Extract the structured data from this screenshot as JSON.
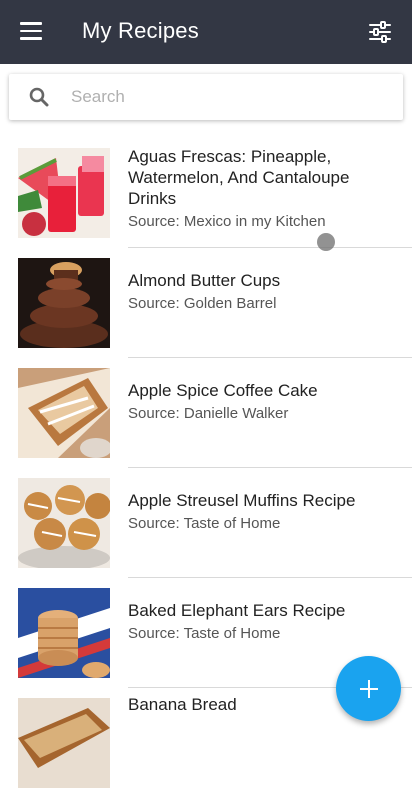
{
  "appbar": {
    "title": "My Recipes",
    "menu_icon": "hamburger-menu-icon",
    "filter_icon": "sliders-filter-icon",
    "background": "#333744"
  },
  "search": {
    "placeholder": "Search",
    "value": "",
    "icon": "search-icon"
  },
  "recipes": [
    {
      "name": "Aguas Frescas: Pineapple, Watermelon, And Cantaloupe Drinks",
      "source": "Source: Mexico in my Kitchen",
      "thumbnail": "red-drinks-photo"
    },
    {
      "name": "Almond Butter Cups",
      "source": "Source: Golden Barrel",
      "thumbnail": "chocolate-cups-photo"
    },
    {
      "name": "Apple Spice Coffee Cake",
      "source": "Source: Danielle Walker",
      "thumbnail": "coffee-cake-photo"
    },
    {
      "name": "Apple Streusel Muffins Recipe",
      "source": "Source: Taste of Home",
      "thumbnail": "muffins-photo"
    },
    {
      "name": "Baked Elephant Ears Recipe",
      "source": "Source: Taste of Home",
      "thumbnail": "cookies-stack-photo"
    },
    {
      "name": "Banana Bread",
      "source": "",
      "thumbnail": "banana-bread-photo"
    }
  ],
  "fab": {
    "icon": "plus-icon",
    "color": "#1aa3ef"
  }
}
